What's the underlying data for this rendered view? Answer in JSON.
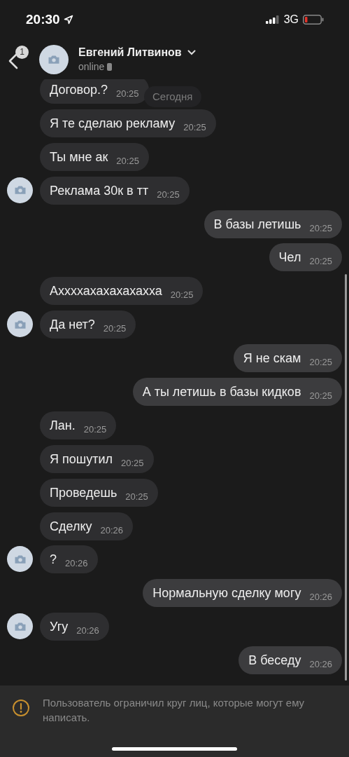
{
  "status_bar": {
    "time": "20:30",
    "network": "3G"
  },
  "header": {
    "back_badge": "1",
    "name": "Евгений Литвинов",
    "presence": "online"
  },
  "date_label": "Сегодня",
  "messages": [
    {
      "kind": "incoming",
      "text": "Договор.?",
      "time": "20:25",
      "avatar": false
    },
    {
      "kind": "incoming",
      "text": "Я те сделаю рекламу",
      "time": "20:25",
      "avatar": false
    },
    {
      "kind": "incoming",
      "text": "Ты мне ак",
      "time": "20:25",
      "avatar": false
    },
    {
      "kind": "incoming",
      "text": "Реклама 30к в тт",
      "time": "20:25",
      "avatar": true
    },
    {
      "kind": "outgoing",
      "text": "В базы летишь",
      "time": "20:25"
    },
    {
      "kind": "outgoing",
      "text": "Чел",
      "time": "20:25"
    },
    {
      "kind": "incoming",
      "text": "Аххххахахахахахха",
      "time": "20:25",
      "avatar": false
    },
    {
      "kind": "incoming",
      "text": "Да нет?",
      "time": "20:25",
      "avatar": true
    },
    {
      "kind": "outgoing",
      "text": "Я не скам",
      "time": "20:25"
    },
    {
      "kind": "outgoing",
      "text": "А ты летишь в базы кидков",
      "time": "20:25"
    },
    {
      "kind": "incoming",
      "text": "Лан.",
      "time": "20:25",
      "avatar": false
    },
    {
      "kind": "incoming",
      "text": "Я пошутил",
      "time": "20:25",
      "avatar": false
    },
    {
      "kind": "incoming",
      "text": "Проведешь",
      "time": "20:25",
      "avatar": false
    },
    {
      "kind": "incoming",
      "text": "Сделку",
      "time": "20:26",
      "avatar": false
    },
    {
      "kind": "incoming",
      "text": "?",
      "time": "20:26",
      "avatar": true
    },
    {
      "kind": "outgoing",
      "text": "Нормальную сделку могу",
      "time": "20:26"
    },
    {
      "kind": "incoming",
      "text": "Угу",
      "time": "20:26",
      "avatar": true
    },
    {
      "kind": "outgoing",
      "text": "В беседу",
      "time": "20:26"
    }
  ],
  "notice": "Пользователь ограничил круг лиц, которые могут ему написать."
}
